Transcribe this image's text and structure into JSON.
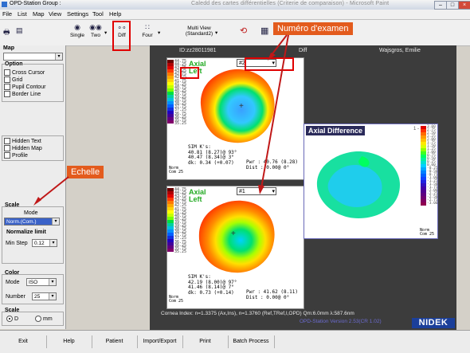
{
  "window": {
    "title": "OPD-Station Group :",
    "title_extra": "Caledd des cartes différentielles (Criterie de comparaison) - Microsoft Paint"
  },
  "menu": [
    "File",
    "List",
    "Map",
    "View",
    "Settings",
    "Tool",
    "Help"
  ],
  "toolbar": {
    "single": "Single",
    "two": "Two",
    "diff": "Diff",
    "four": "Four",
    "multi_view": "Multi View",
    "multi_view_sub": "(Standard2)"
  },
  "left": {
    "map_label": "Map",
    "option_label": "Option",
    "options": [
      "Cross Cursor",
      "Grid",
      "Pupil Contour",
      "Border Line"
    ],
    "options2": [
      "Hidden Text",
      "Hidden Map",
      "Profile"
    ],
    "scale_label": "Scale",
    "mode_label": "Mode",
    "mode_value": "Norm.(Com.)",
    "normalize_label": "Normalize limit",
    "min_step_label": "Min Step",
    "min_step_value": "0.12",
    "color_label": "Color",
    "color_mode_label": "Mode",
    "color_mode_value": "ISO",
    "number_label": "Number",
    "number_value": "25",
    "scale2_label": "Scale",
    "scale_d": "D",
    "scale_mm": "mm"
  },
  "annotations": {
    "numero": "Numéro d'examen",
    "echelle": "Echelle"
  },
  "header": {
    "id": "ID:zz28011981",
    "mode": "Diff",
    "patient": "Wajsgros, Emilie"
  },
  "map1": {
    "exam": "#2",
    "label": "Axial\nLeft",
    "sim_title": "SIM K's:",
    "sim1": "40.81 (8.27)@ 93°",
    "sim2": "40.47 (8.34)@ 3°",
    "sim3": "dk: 0.34 (+0.07)",
    "pwr": "Pwr :   40.76 (8.28)",
    "dist": "Dist :  0.00@  0°",
    "scale": [
      "44.75",
      "44.25",
      "43.75",
      "43.25",
      "42.75",
      "42.25",
      "41.75",
      "41.25",
      "40.75",
      "40.25",
      "39.75",
      "39.25",
      "38.75",
      "38.25",
      "37.75",
      "37.25",
      "36.75",
      "36.25",
      "35.75",
      "35.25"
    ],
    "norm": "Norm\nCom 25"
  },
  "map2": {
    "exam": "#1",
    "label": "Axial\nLeft",
    "sim_title": "SIM K's:",
    "sim1": "42.19 (8.00)@ 97°",
    "sim2": "41.46 (8.14)@ 7°",
    "sim3": "dk: 0.73 (+0.14)",
    "pwr": "Pwr :   41.62 (8.11)",
    "dist": "Dist :  0.00@  0°",
    "norm": "Norm\nCom 25"
  },
  "diff": {
    "title": "Axial Difference",
    "tag": "1 - 2",
    "scale": [
      "3.00",
      "2.75",
      "2.50",
      "2.25",
      "2.00",
      "1.75",
      "1.50",
      "1.25",
      "1.00",
      "0.75",
      "0.50",
      "0.25",
      "0.00",
      "-0.25",
      "-0.50",
      "-0.75",
      "-1.00",
      "-1.25",
      "-1.50",
      "-1.75",
      "-2.00",
      "-2.25",
      "-2.50",
      "-2.75",
      "-3.00"
    ],
    "norm": "Norm\nCom 25"
  },
  "footer": {
    "cornea": "Cornea Index: n=1.3375 (Ax,Ins), n=1.3760 (Ref,TRef,I,OPD)  Qm:6.0mm  λ:587.6nm",
    "version": "OPD-Station Version 2.53(CR 1.02)",
    "brand": "NIDEK"
  },
  "bottom_buttons": [
    "Exit",
    "Help",
    "Patient",
    "Import/Export",
    "Print",
    "Batch Process"
  ],
  "colors": {
    "annotation": "#e00000",
    "callout": "#e35b1d",
    "brand": "#1b3f9a"
  }
}
